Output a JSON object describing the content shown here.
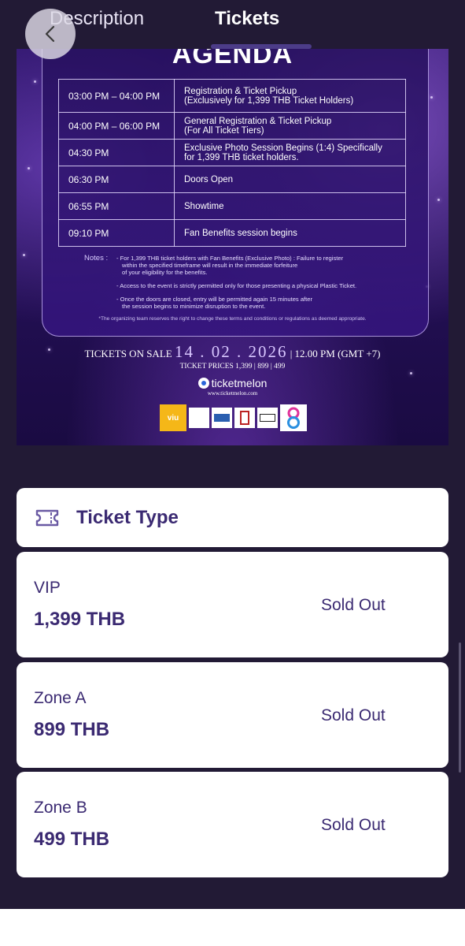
{
  "header": {
    "tabs": [
      {
        "label": "Description",
        "active": false
      },
      {
        "label": "Tickets",
        "active": true
      }
    ],
    "back_icon": "chevron-left-icon"
  },
  "poster": {
    "title": "AGENDA",
    "schedule": [
      {
        "time": "03:00 PM – 04:00 PM",
        "line1": "Registration & Ticket Pickup",
        "line2": "(Exclusively for 1,399 THB Ticket Holders)"
      },
      {
        "time": "04:00 PM – 06:00 PM",
        "line1": "General Registration & Ticket Pickup",
        "line2": "(For All Ticket Tiers)"
      },
      {
        "time": "04:30 PM",
        "line1": "Exclusive Photo Session Begins (1:4) Specifically",
        "line2": "for 1,399 THB ticket holders."
      },
      {
        "time": "06:30 PM",
        "line1": "Doors Open",
        "line2": ""
      },
      {
        "time": "06:55 PM",
        "line1": "Showtime",
        "line2": ""
      },
      {
        "time": "09:10 PM",
        "line1": "Fan Benefits session begins",
        "line2": ""
      }
    ],
    "notes_label": "Notes :",
    "notes": [
      [
        "- For 1,399 THB ticket holders with Fan Benefits (Exclusive Photo) : Failure to register",
        "within the specified timeframe will result in the immediate forfeiture",
        "of your eligibility for the benefits."
      ],
      [
        "- Access to the event is strictly permitted only for those presenting a physical Plastic Ticket."
      ],
      [
        "- Once the doors are closed, entry will be permitted again 15 minutes after",
        "the session begins to minimize disruption to the event."
      ]
    ],
    "disclaimer": "*The organizing team reserves the right to change these terms and conditions or regulations as deemed appropriate.",
    "sale_prefix": "TICKETS ON SALE",
    "sale_date": "14 . 02 . 2026",
    "sale_time": "| 12.00 PM (GMT +7)",
    "ticket_prices": "TICKET PRICES 1,399 | 899 | 499",
    "brand": "ticketmelon",
    "brand_url": "www.ticketmelon.com",
    "sponsors": [
      "viu",
      "",
      "",
      "",
      "",
      ""
    ]
  },
  "ticket_section": {
    "title": "Ticket Type",
    "icon": "ticket-icon",
    "tiers": [
      {
        "name": "VIP",
        "price": "1,399 THB",
        "status": "Sold Out"
      },
      {
        "name": "Zone A",
        "price": "899 THB",
        "status": "Sold Out"
      },
      {
        "name": "Zone B",
        "price": "499 THB",
        "status": "Sold Out"
      }
    ]
  },
  "colors": {
    "background": "#221a35",
    "accent": "#3b2a72",
    "tab_indicator": "#4c3c88"
  }
}
